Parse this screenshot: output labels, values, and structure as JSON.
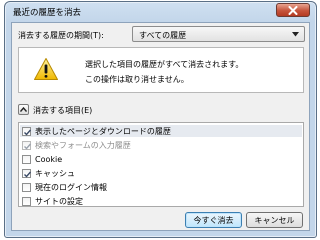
{
  "dialog": {
    "title": "最近の履歴を消去",
    "period_label": "消去する履歴の期間(T):",
    "period_value": "すべての履歴",
    "warning_line1": "選択した項目の履歴がすべて消去されます。",
    "warning_line2": "この操作は取り消せません。",
    "items_label": "消去する項目(E)",
    "items": [
      {
        "label": "表示したページとダウンロードの履歴",
        "checked": true,
        "enabled": true,
        "selected": true
      },
      {
        "label": "検索やフォームの入力履歴",
        "checked": true,
        "enabled": false,
        "selected": false
      },
      {
        "label": "Cookie",
        "checked": false,
        "enabled": true,
        "selected": false
      },
      {
        "label": "キャッシュ",
        "checked": true,
        "enabled": true,
        "selected": false
      },
      {
        "label": "現在のログイン情報",
        "checked": false,
        "enabled": true,
        "selected": false
      },
      {
        "label": "サイトの設定",
        "checked": false,
        "enabled": true,
        "selected": false
      }
    ],
    "buttons": {
      "clear_now": "今すぐ消去",
      "cancel": "キャンセル"
    }
  },
  "icons": {
    "close": "close-icon",
    "warning": "warning-icon",
    "dropdown": "chevron-down-icon",
    "expander": "chevron-up-icon",
    "check": "check-icon"
  },
  "colors": {
    "titlebar": "#c3d6ea",
    "close_button": "#c6543c",
    "warning_yellow": "#f5c400",
    "client_bg": "#f0f0f0",
    "primary_button_border": "#3c7fb1"
  }
}
